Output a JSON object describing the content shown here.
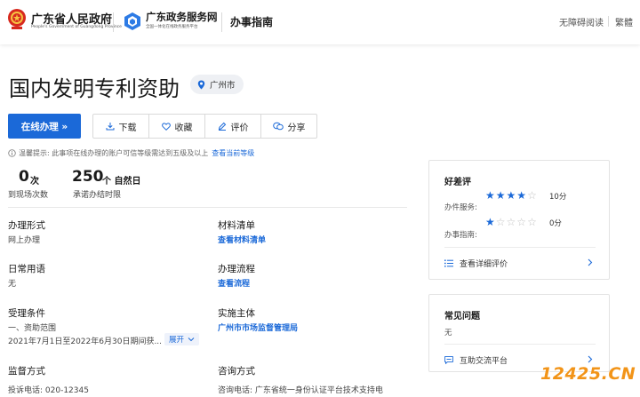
{
  "header": {
    "gov_title": "广东省人民政府",
    "gov_subtitle": "People's Government of Guangdong Province",
    "service_title": "广东政务服务网",
    "service_subtitle": "全国一体化在线政务服务平台",
    "section": "办事指南",
    "accessibility": "无障碍阅读",
    "traditional": "繁體",
    "brand_color": "#1b69d8"
  },
  "page": {
    "title": "国内发明专利资助",
    "location": "广州市"
  },
  "actions": {
    "online": "在线办理 »",
    "download": "下载",
    "favorite": "收藏",
    "rate": "评价",
    "share": "分享"
  },
  "tip": {
    "text": "温馨提示:  此事项在线办理的账户可信等级需达到五级及以上",
    "link": "查看当前等级"
  },
  "stats": {
    "visits_value": "0",
    "visits_unit": "次",
    "visits_label": "到现场次数",
    "days_value": "250",
    "days_unit": "个 自然日",
    "days_label": "承诺办结时限"
  },
  "info": {
    "mode_label": "办理形式",
    "mode_value": "网上办理",
    "materials_label": "材料清单",
    "materials_value": "查看材料清单",
    "common_label": "日常用语",
    "common_value": "无",
    "process_label": "办理流程",
    "process_value": "查看流程",
    "conditions_label": "受理条件",
    "conditions_line1": "一、资助范围",
    "conditions_line2": "2021年7月1日至2022年6月30日期间获...",
    "expand": "展开",
    "subject_label": "实施主体",
    "subject_value": "广州市市场监督管理局",
    "supervise_label": "监督方式",
    "supervise_value": "投诉电话: 020-12345",
    "consult_label": "咨询方式",
    "consult_value": "咨询电话: 广东省统一身份认证平台技术支持电"
  },
  "rating_card": {
    "title": "好差评",
    "service_label": "办件服务:",
    "service_score": "10分",
    "service_stars": 4,
    "guide_label": "办事指南:",
    "guide_score": "0分",
    "guide_stars": 1,
    "total_stars": 5,
    "detail_link": "查看详细评价"
  },
  "faq_card": {
    "title": "常见问题",
    "content": "无",
    "platform_link": "互助交流平台"
  },
  "watermark": {
    "digits": "12425.",
    "suffix": "CN"
  }
}
